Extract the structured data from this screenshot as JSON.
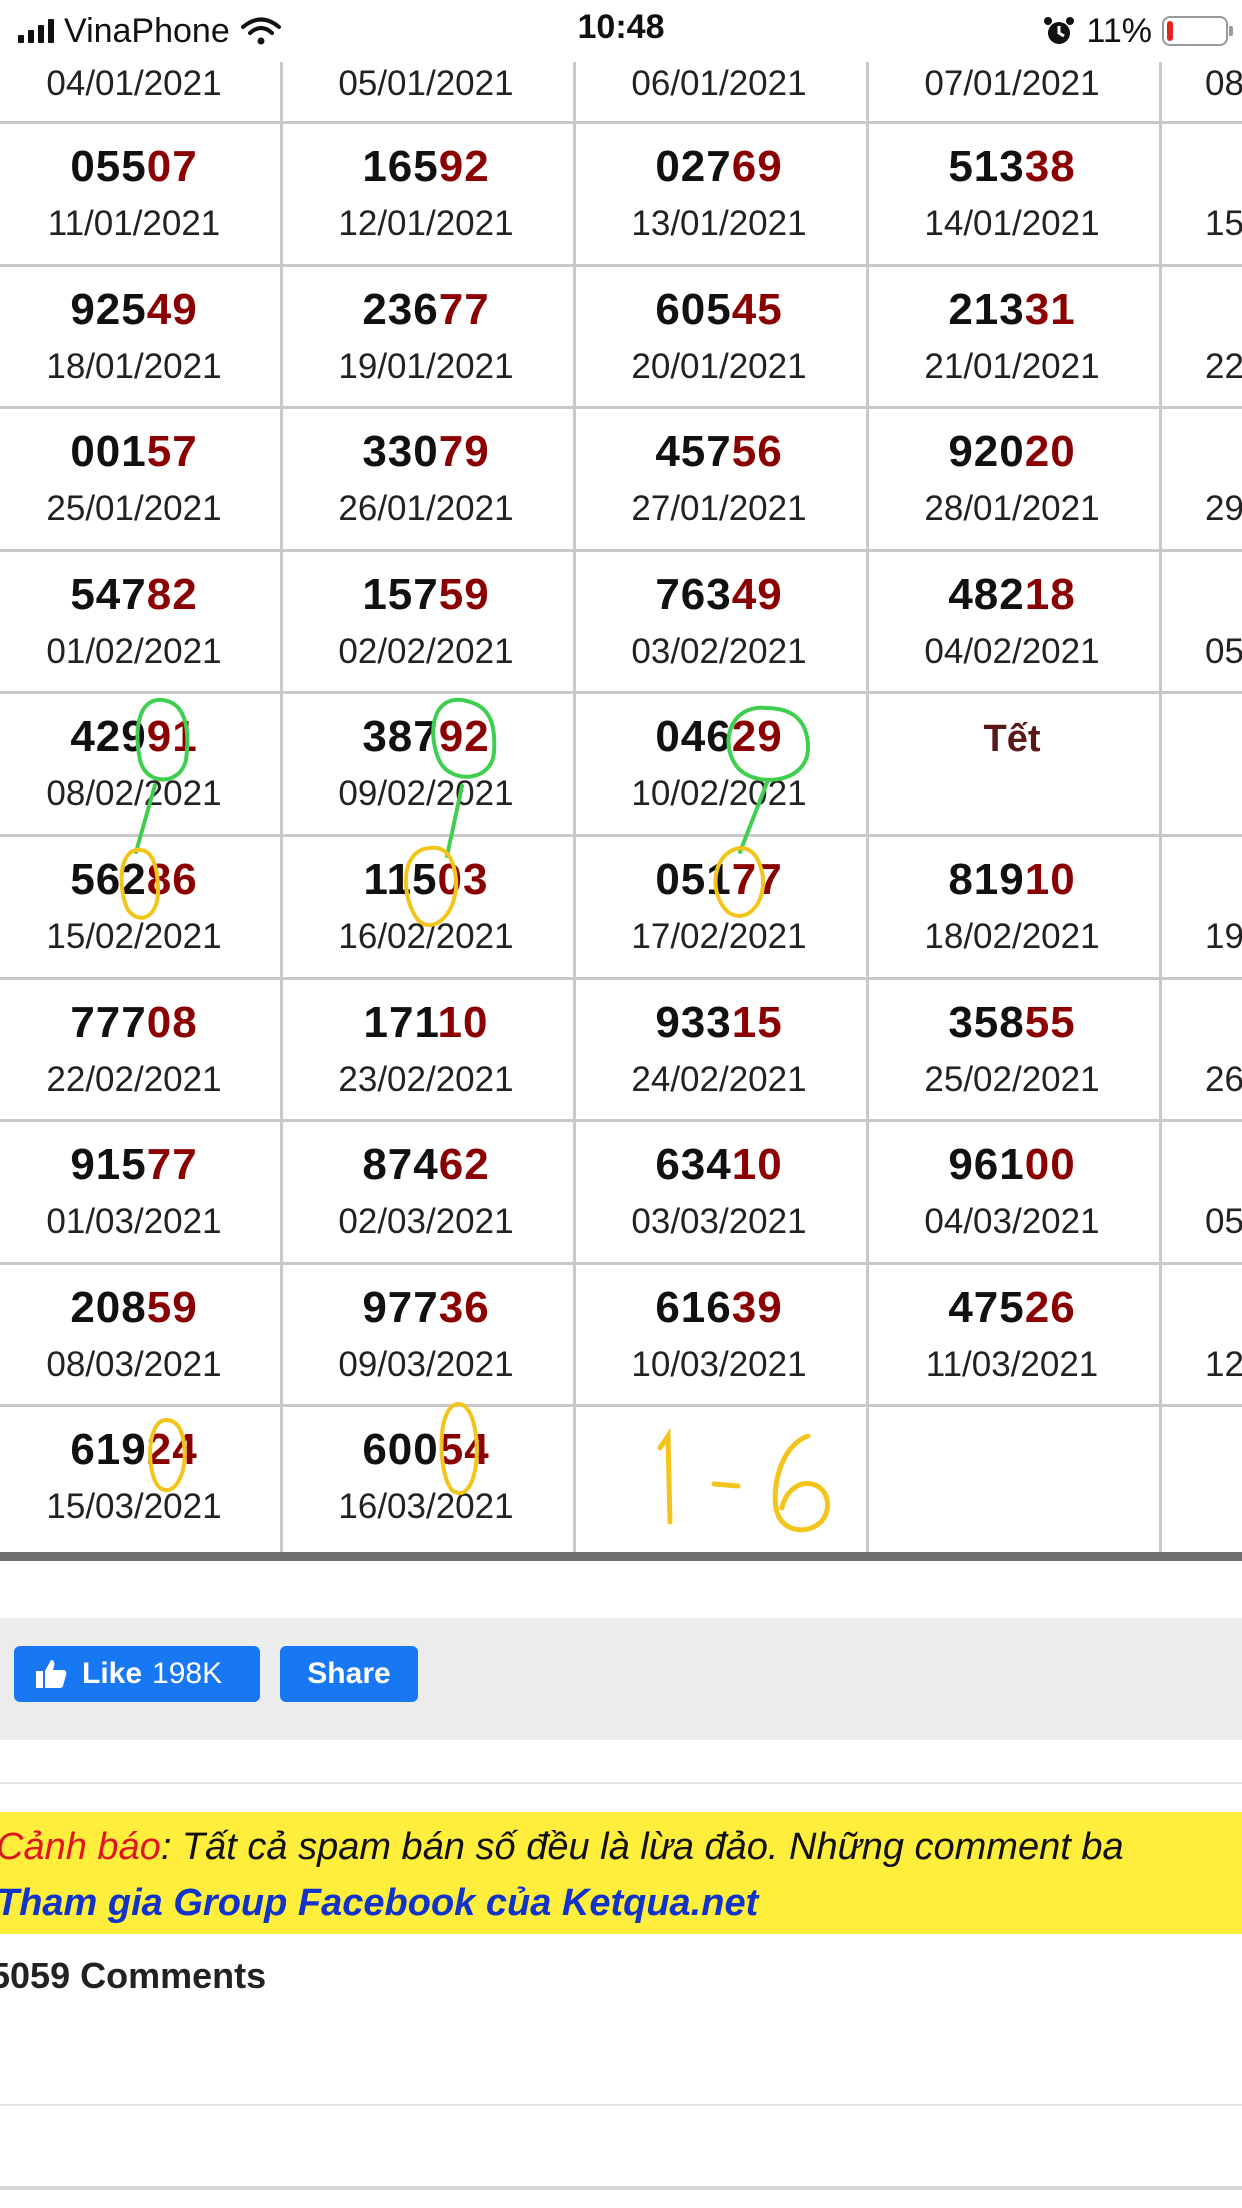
{
  "status_bar": {
    "carrier": "VinaPhone",
    "time": "10:48",
    "battery_percent": "11%",
    "battery_level": 0.11,
    "icons": [
      "signal-icon",
      "wifi-icon",
      "alarm-icon",
      "battery-icon"
    ]
  },
  "table": {
    "top_dates": [
      "04/01/2021",
      "05/01/2021",
      "06/01/2021",
      "07/01/2021",
      "08"
    ],
    "rows": [
      {
        "cells": [
          {
            "num": "055",
            "tail": "07",
            "date": "11/01/2021"
          },
          {
            "num": "165",
            "tail": "92",
            "date": "12/01/2021"
          },
          {
            "num": "027",
            "tail": "69",
            "date": "13/01/2021"
          },
          {
            "num": "513",
            "tail": "38",
            "date": "14/01/2021"
          },
          {
            "num": "",
            "tail": "",
            "date": "15"
          }
        ]
      },
      {
        "cells": [
          {
            "num": "925",
            "tail": "49",
            "date": "18/01/2021"
          },
          {
            "num": "236",
            "tail": "77",
            "date": "19/01/2021"
          },
          {
            "num": "605",
            "tail": "45",
            "date": "20/01/2021"
          },
          {
            "num": "213",
            "tail": "31",
            "date": "21/01/2021"
          },
          {
            "num": "",
            "tail": "",
            "date": "22"
          }
        ]
      },
      {
        "cells": [
          {
            "num": "001",
            "tail": "57",
            "date": "25/01/2021"
          },
          {
            "num": "330",
            "tail": "79",
            "date": "26/01/2021"
          },
          {
            "num": "457",
            "tail": "56",
            "date": "27/01/2021"
          },
          {
            "num": "920",
            "tail": "20",
            "date": "28/01/2021"
          },
          {
            "num": "",
            "tail": "",
            "date": "29"
          }
        ]
      },
      {
        "cells": [
          {
            "num": "547",
            "tail": "82",
            "date": "01/02/2021"
          },
          {
            "num": "157",
            "tail": "59",
            "date": "02/02/2021"
          },
          {
            "num": "763",
            "tail": "49",
            "date": "03/02/2021"
          },
          {
            "num": "482",
            "tail": "18",
            "date": "04/02/2021"
          },
          {
            "num": "",
            "tail": "",
            "date": "05"
          }
        ]
      },
      {
        "cells": [
          {
            "num": "429",
            "tail": "91",
            "date": "08/02/2021"
          },
          {
            "num": "387",
            "tail": "92",
            "date": "09/02/2021"
          },
          {
            "num": "046",
            "tail": "29",
            "date": "10/02/2021"
          },
          {
            "text": "Tết"
          },
          {
            "num": "",
            "tail": "",
            "date": ""
          }
        ]
      },
      {
        "cells": [
          {
            "num": "562",
            "tail": "86",
            "date": "15/02/2021"
          },
          {
            "num": "115",
            "tail": "03",
            "date": "16/02/2021"
          },
          {
            "num": "051",
            "tail": "77",
            "date": "17/02/2021"
          },
          {
            "num": "819",
            "tail": "10",
            "date": "18/02/2021"
          },
          {
            "num": "",
            "tail": "",
            "date": "19"
          }
        ]
      },
      {
        "cells": [
          {
            "num": "777",
            "tail": "08",
            "date": "22/02/2021"
          },
          {
            "num": "171",
            "tail": "10",
            "date": "23/02/2021"
          },
          {
            "num": "933",
            "tail": "15",
            "date": "24/02/2021"
          },
          {
            "num": "358",
            "tail": "55",
            "date": "25/02/2021"
          },
          {
            "num": "",
            "tail": "",
            "date": "26"
          }
        ]
      },
      {
        "cells": [
          {
            "num": "915",
            "tail": "77",
            "date": "01/03/2021"
          },
          {
            "num": "874",
            "tail": "62",
            "date": "02/03/2021"
          },
          {
            "num": "634",
            "tail": "10",
            "date": "03/03/2021"
          },
          {
            "num": "961",
            "tail": "00",
            "date": "04/03/2021"
          },
          {
            "num": "",
            "tail": "",
            "date": "05"
          }
        ]
      },
      {
        "cells": [
          {
            "num": "208",
            "tail": "59",
            "date": "08/03/2021"
          },
          {
            "num": "977",
            "tail": "36",
            "date": "09/03/2021"
          },
          {
            "num": "616",
            "tail": "39",
            "date": "10/03/2021"
          },
          {
            "num": "475",
            "tail": "26",
            "date": "11/03/2021"
          },
          {
            "num": "",
            "tail": "",
            "date": "12"
          }
        ]
      },
      {
        "cells": [
          {
            "num": "619",
            "tail": "24",
            "date": "15/03/2021"
          },
          {
            "num": "600",
            "tail": "54",
            "date": "16/03/2021"
          },
          {
            "num": "",
            "tail": "",
            "date": ""
          },
          {
            "num": "",
            "tail": "",
            "date": ""
          },
          {
            "num": "",
            "tail": "",
            "date": ""
          }
        ]
      }
    ]
  },
  "annotation": {
    "handwritten_text": "1-6",
    "circle_color": "#3fcf4f",
    "tail_circle_color": "#f3c51a"
  },
  "social": {
    "like_label": "Like",
    "like_count": "198K",
    "share_label": "Share",
    "brand_color": "#1877f2"
  },
  "warning": {
    "label": "Cảnh báo",
    "text": ": Tất cả spam bán số đều là lừa đảo. Những comment ba",
    "group_link": "Tham gia Group Facebook của Ketqua.net"
  },
  "comments_count": "5059 Comments",
  "colors": {
    "tail_digits": "#8b0000",
    "warning_bg": "#ffee3b",
    "warning_label": "#e0161f",
    "group_link": "#1033c9"
  }
}
